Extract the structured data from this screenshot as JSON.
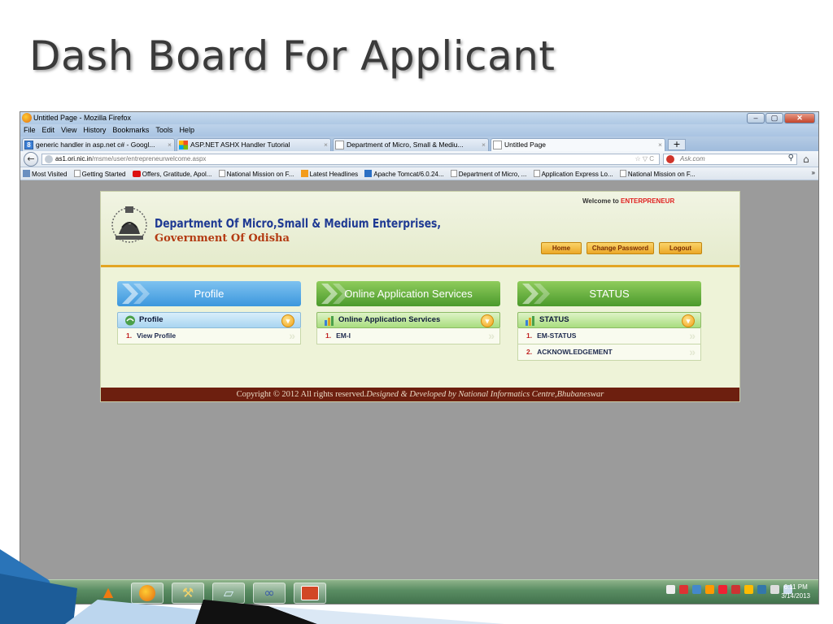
{
  "slide": {
    "title": "Dash Board For Applicant"
  },
  "browser": {
    "window_title": "Untitled Page - Mozilla Firefox",
    "menu": [
      "File",
      "Edit",
      "View",
      "History",
      "Bookmarks",
      "Tools",
      "Help"
    ],
    "tabs": [
      {
        "label": "generic handler in asp.net c# - Googl...",
        "close": "×",
        "icon": "google-icon"
      },
      {
        "label": "ASP.NET ASHX Handler Tutorial",
        "close": "×",
        "icon": "windows-icon"
      },
      {
        "label": "Department of Micro, Small & Mediu...",
        "close": "×",
        "icon": "page-icon"
      },
      {
        "label": "Untitled Page",
        "close": "×",
        "icon": "page-icon",
        "active": true
      }
    ],
    "new_tab": "+",
    "url_domain": "as1.ori.nic.in",
    "url_path": "/msme/user/entrepreneurwelcome.aspx",
    "url_controls": "☆ ▽ C",
    "search_placeholder": "Ask.com",
    "bookmarks": [
      "Most Visited",
      "Getting Started",
      "Offers, Gratitude, Apol...",
      "National Mission on F...",
      "Latest Headlines",
      "Apache Tomcat/6.0.24...",
      "Department of Micro, ...",
      "Application Express Lo...",
      "National Mission on F..."
    ],
    "bookmarks_more": "»"
  },
  "page": {
    "welcome_prefix": "Welcome to",
    "welcome_user": "ENTERPRENEUR",
    "dept_name": "Department Of Micro,Small & Medium Enterprises,",
    "government": "Government Of Odisha",
    "nav": {
      "home": "Home",
      "change_password": "Change Password",
      "logout": "Logout"
    },
    "panels": [
      {
        "header": "Profile",
        "sub": "Profile",
        "items": [
          {
            "num": "1.",
            "label": "View Profile"
          }
        ]
      },
      {
        "header": "Online Application Services",
        "sub": "Online Application Services",
        "items": [
          {
            "num": "1.",
            "label": "EM-I"
          }
        ]
      },
      {
        "header": "STATUS",
        "sub": "STATUS",
        "items": [
          {
            "num": "1.",
            "label": "EM-STATUS"
          },
          {
            "num": "2.",
            "label": "ACKNOWLEDGEMENT"
          }
        ]
      }
    ],
    "footer_plain": "Copyright © 2012 All rights reserved.",
    "footer_italic": "Designed & Developed by National Informatics Centre,Bhubaneswar"
  },
  "taskbar": {
    "time": "6:11 PM",
    "date": "3/14/2013"
  },
  "colors": {
    "accent_orange": "#e3a523",
    "footer_maroon": "#6d1f0f",
    "dept_blue": "#1f3a93",
    "gov_red": "#b33a12",
    "panel_blue": "#3c97dd",
    "panel_green": "#4b9a2c"
  }
}
